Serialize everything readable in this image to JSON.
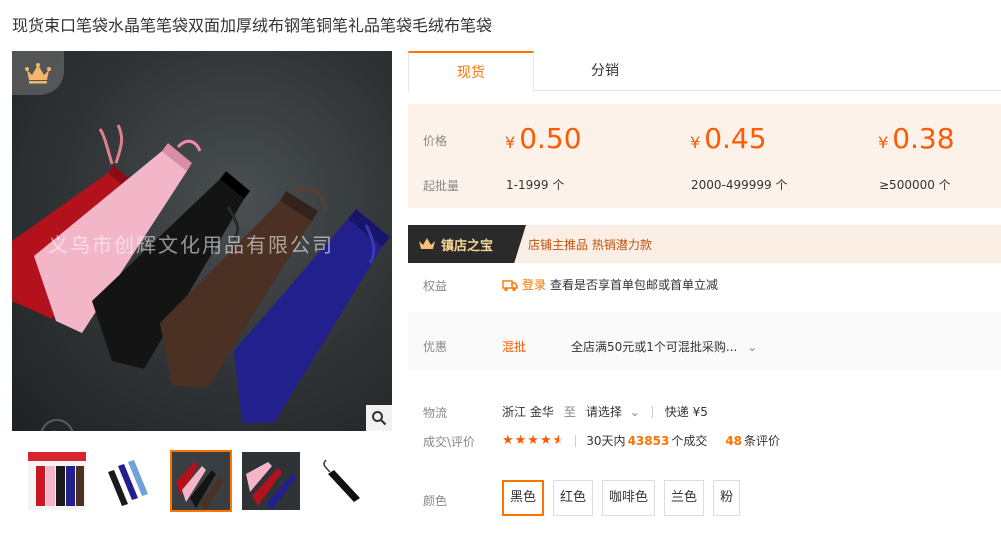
{
  "product": {
    "title": "现货束口笔袋水晶笔笔袋双面加厚绒布钢笔铜笔礼品笔袋毛绒布笔袋",
    "watermark": "义乌市创辉文化用品有限公司"
  },
  "gallery": {
    "icons": {
      "badge": "crown-icon",
      "zoom": "magnifier-icon",
      "play": "play-icon"
    },
    "thumbnails": [
      {
        "name": "thumb-1"
      },
      {
        "name": "thumb-2"
      },
      {
        "name": "thumb-3",
        "active": true
      },
      {
        "name": "thumb-4"
      },
      {
        "name": "thumb-5"
      }
    ]
  },
  "tabs": {
    "active": "现货",
    "other": "分销"
  },
  "pricing": {
    "price_label": "价格",
    "moq_label": "起批量",
    "currency": "¥",
    "tiers": [
      {
        "price": "0.50",
        "range": "1-1999 个"
      },
      {
        "price": "0.45",
        "range": "2000-499999 个"
      },
      {
        "price": "0.38",
        "range": "≥500000 个"
      }
    ]
  },
  "treasure": {
    "tag": "镇店之宝",
    "text": "店铺主推品  热销潜力款"
  },
  "benefit": {
    "label": "权益",
    "login": "登录",
    "text": "查看是否享首单包邮或首单立减"
  },
  "promo": {
    "label": "优惠",
    "tag": "混批",
    "text": "全店满50元或1个可混批采购..."
  },
  "shipping": {
    "label": "物流",
    "from": "浙江 金华",
    "to_word": "至",
    "select": "请选择",
    "method": "快递 ¥5"
  },
  "deal": {
    "label": "成交\\评价",
    "rating": 4.5,
    "days_prefix": "30天内",
    "count": "43853",
    "count_suffix": "个成交",
    "reviews": "48",
    "reviews_suffix": "条评价"
  },
  "colors": {
    "label": "颜色",
    "options": [
      "黑色",
      "红色",
      "咖啡色",
      "兰色",
      "粉"
    ],
    "selected": "黑色"
  },
  "theme": {
    "accent": "#ff7300",
    "price": "#ff5a00",
    "price_bg": "#fdf2ea"
  }
}
